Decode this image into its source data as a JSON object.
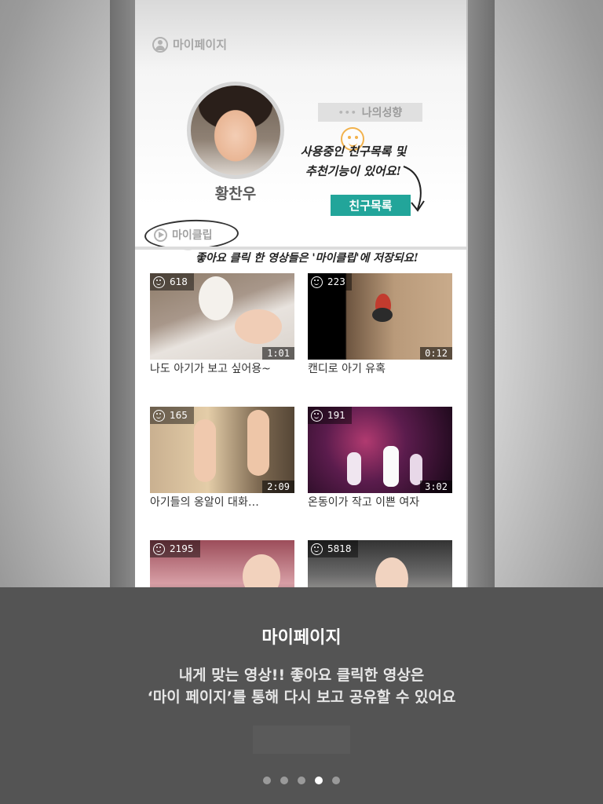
{
  "screen": {
    "header": {
      "label": "마이페이지",
      "icon": "user-circle-icon"
    },
    "profile": {
      "name": "황찬우"
    },
    "tendency_button": {
      "label": "나의성향",
      "icon": "dots-icon"
    },
    "friend_button": {
      "label": "친구목록",
      "color": "#22a59a"
    },
    "annotation_friend": {
      "line1": "사용중인 친구목록 및",
      "line2": "추천기능이 있어요!"
    },
    "annotation_clip": "좋아요 클릭 한 영상들은 '마이클립'에 저장되요!",
    "myclip_tab": {
      "label": "마이클립",
      "icon": "play-circle-icon"
    },
    "clips": [
      {
        "likes": "618",
        "duration": "1:01",
        "title": "나도 아기가 보고 싶어용~"
      },
      {
        "likes": "223",
        "duration": "0:12",
        "title": "캔디로 아기 유혹"
      },
      {
        "likes": "165",
        "duration": "2:09",
        "title": "아기들의 옹알이 대화…"
      },
      {
        "likes": "191",
        "duration": "3:02",
        "title": "온동이가 작고 이쁜 여자"
      },
      {
        "likes": "2195",
        "duration": "",
        "title": ""
      },
      {
        "likes": "5818",
        "duration": "",
        "title": ""
      }
    ]
  },
  "overlay": {
    "title": "마이페이지",
    "description_line1": "내게 맞는 영상!! 좋아요 클릭한 영상은",
    "description_line2": "‘마이 페이지’를 통해 다시 보고 공유할 수 있어요"
  },
  "pager": {
    "total": 5,
    "active_index": 3
  },
  "colors": {
    "accent": "#22a59a",
    "overlay_bg": "#545454"
  }
}
